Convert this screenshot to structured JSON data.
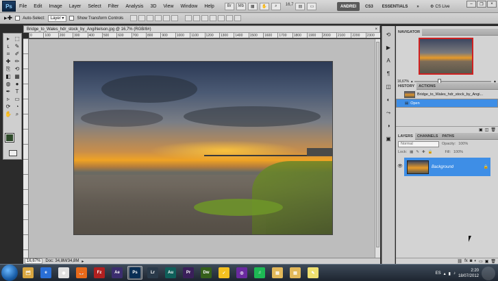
{
  "app": {
    "name": "Photoshop",
    "logo": "Ps"
  },
  "menu": {
    "items": [
      "File",
      "Edit",
      "Image",
      "Layer",
      "Select",
      "Filter",
      "Analysis",
      "3D",
      "View",
      "Window",
      "Help"
    ],
    "zoom_readout": "16,7"
  },
  "workspace": {
    "buttons": [
      "ANDREI",
      "CS3",
      "ESSENTIALS",
      "»"
    ],
    "active": "ANDREI",
    "cs_live": "CS Live"
  },
  "options_bar": {
    "auto_select_label": "Auto-Select:",
    "auto_select_value": "Layer",
    "show_transform_label": "Show Transform Controls"
  },
  "toolbox": {
    "tools": [
      "move-icon",
      "marquee-icon",
      "lasso-icon",
      "quick-select-icon",
      "crop-icon",
      "eyedropper-icon",
      "healing-icon",
      "brush-icon",
      "stamp-icon",
      "history-brush-icon",
      "eraser-icon",
      "gradient-icon",
      "blur-icon",
      "dodge-icon",
      "pen-icon",
      "type-icon",
      "path-select-icon",
      "shape-icon",
      "3d-rotate-icon",
      "3d-camera-icon",
      "hand-icon",
      "zoom-icon"
    ],
    "glyphs": [
      "▸",
      "⬚",
      "ʟ",
      "✎",
      "⌗",
      "✐",
      "✚",
      "✏",
      "⎘",
      "⟲",
      "◧",
      "▦",
      "◍",
      "●",
      "✒",
      "T",
      "▹",
      "▭",
      "⟳",
      "◔",
      "✋",
      "⌕"
    ],
    "foreground_color": "#2e4a2a",
    "background_color": "#1a1a1a"
  },
  "document": {
    "tab_title": "Bridge_to_Wales_hdr_stock_by_AngiNelson.jpg @ 16,7% (RGB/8#)",
    "close": "×",
    "ruler_ticks": [
      "0",
      "100",
      "200",
      "300",
      "400",
      "500",
      "600",
      "700",
      "800",
      "900",
      "1000",
      "1100",
      "1200",
      "1300",
      "1400",
      "1500",
      "1600",
      "1700",
      "1800",
      "1900",
      "2000",
      "2100",
      "2200",
      "2300"
    ],
    "status_zoom": "16,67%",
    "status_doc": "Doc: 34,8M/34,8M"
  },
  "right_strip_icons": {
    "names": [
      "history-icon",
      "actions-icon",
      "character-icon",
      "paragraph-icon",
      "layers-icon",
      "channels-icon",
      "paths-icon",
      "adjustments-icon",
      "masks-icon"
    ],
    "glyphs": [
      "⟲",
      "▶",
      "A",
      "¶",
      "◫",
      "◐",
      "⤳",
      "◑",
      "▣"
    ]
  },
  "navigator": {
    "title": "NAVIGATOR",
    "zoom": "16,67%"
  },
  "history": {
    "tabs": [
      "HISTORY",
      "ACTIONS"
    ],
    "rows": [
      {
        "label": "Bridge_to_Wales_hdr_stock_by_Angi..."
      },
      {
        "label": "Open"
      }
    ]
  },
  "layers": {
    "tabs": [
      "LAYERS",
      "CHANNELS",
      "PATHS"
    ],
    "blend_mode": "Normal",
    "opacity_label": "Opacity:",
    "opacity_value": "100%",
    "lock_label": "Lock:",
    "fill_label": "Fill:",
    "fill_value": "100%",
    "layer_name": "Background"
  },
  "taskbar": {
    "apps": [
      "Windows Explorer",
      "Internet Explorer",
      "Chrome",
      "Firefox",
      "FileZilla",
      "After Effects",
      "Photoshop",
      "Lightroom",
      "Audition",
      "Premiere",
      "Dreamweaver",
      "Norton",
      "Media Player",
      "Spotify",
      "Folder",
      "Folder",
      "Notes"
    ],
    "app_labels": [
      "🗂",
      "e",
      "◉",
      "🦊",
      "Fz",
      "Ae",
      "Ps",
      "Lr",
      "Au",
      "Pr",
      "Dw",
      "✓",
      "◎",
      "♫",
      "▤",
      "▤",
      "✎"
    ],
    "active_app": "Photoshop",
    "tray_lang": "ES",
    "time": "2:20",
    "date": "18/07/2012"
  }
}
